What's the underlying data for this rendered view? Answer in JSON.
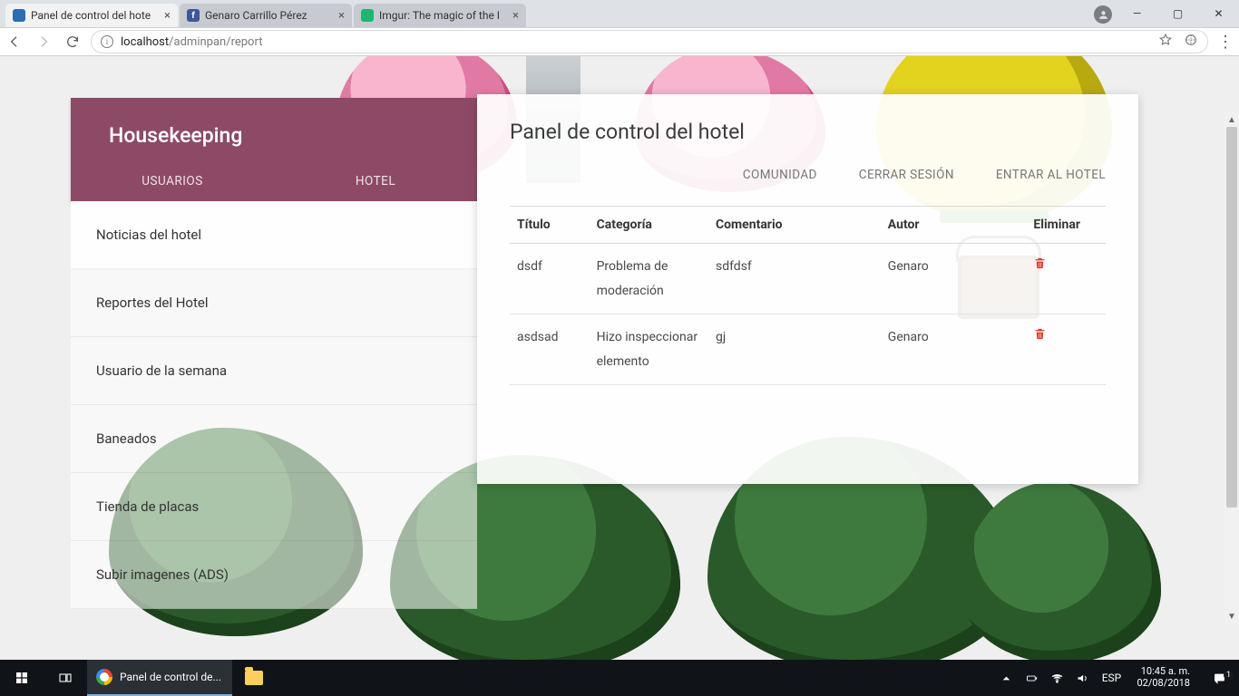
{
  "browser": {
    "tabs": [
      {
        "title": "Panel de control del hote"
      },
      {
        "title": "Genaro Carrillo Pérez"
      },
      {
        "title": "Imgur: The magic of the I"
      }
    ],
    "url_host": "localhost",
    "url_path": "/adminpan/report"
  },
  "sidebar": {
    "title": "Housekeeping",
    "tabs": [
      "USUARIOS",
      "HOTEL"
    ],
    "items": [
      "Noticias del hotel",
      "Reportes del Hotel",
      "Usuario de la semana",
      "Baneados",
      "Tienda de placas",
      "Subir imagenes (ADS)"
    ]
  },
  "panel": {
    "title": "Panel de control del hotel",
    "nav": [
      "COMUNIDAD",
      "CERRAR SESIÓN",
      "ENTRAR AL HOTEL"
    ],
    "headers": [
      "Título",
      "Categoría",
      "Comentario",
      "Autor",
      "Eliminar"
    ],
    "rows": [
      {
        "titulo": "dsdf",
        "categoria": "Problema de moderación",
        "comentario": "sdfdsf",
        "autor": "Genaro"
      },
      {
        "titulo": "asdsad",
        "categoria": "Hizo inspeccionar elemento",
        "comentario": "gj",
        "autor": "Genaro"
      }
    ]
  },
  "taskbar": {
    "app_title": "Panel de control de...",
    "lang": "ESP",
    "time": "10:45 a. m.",
    "date": "02/08/2018",
    "notif_count": "1"
  }
}
